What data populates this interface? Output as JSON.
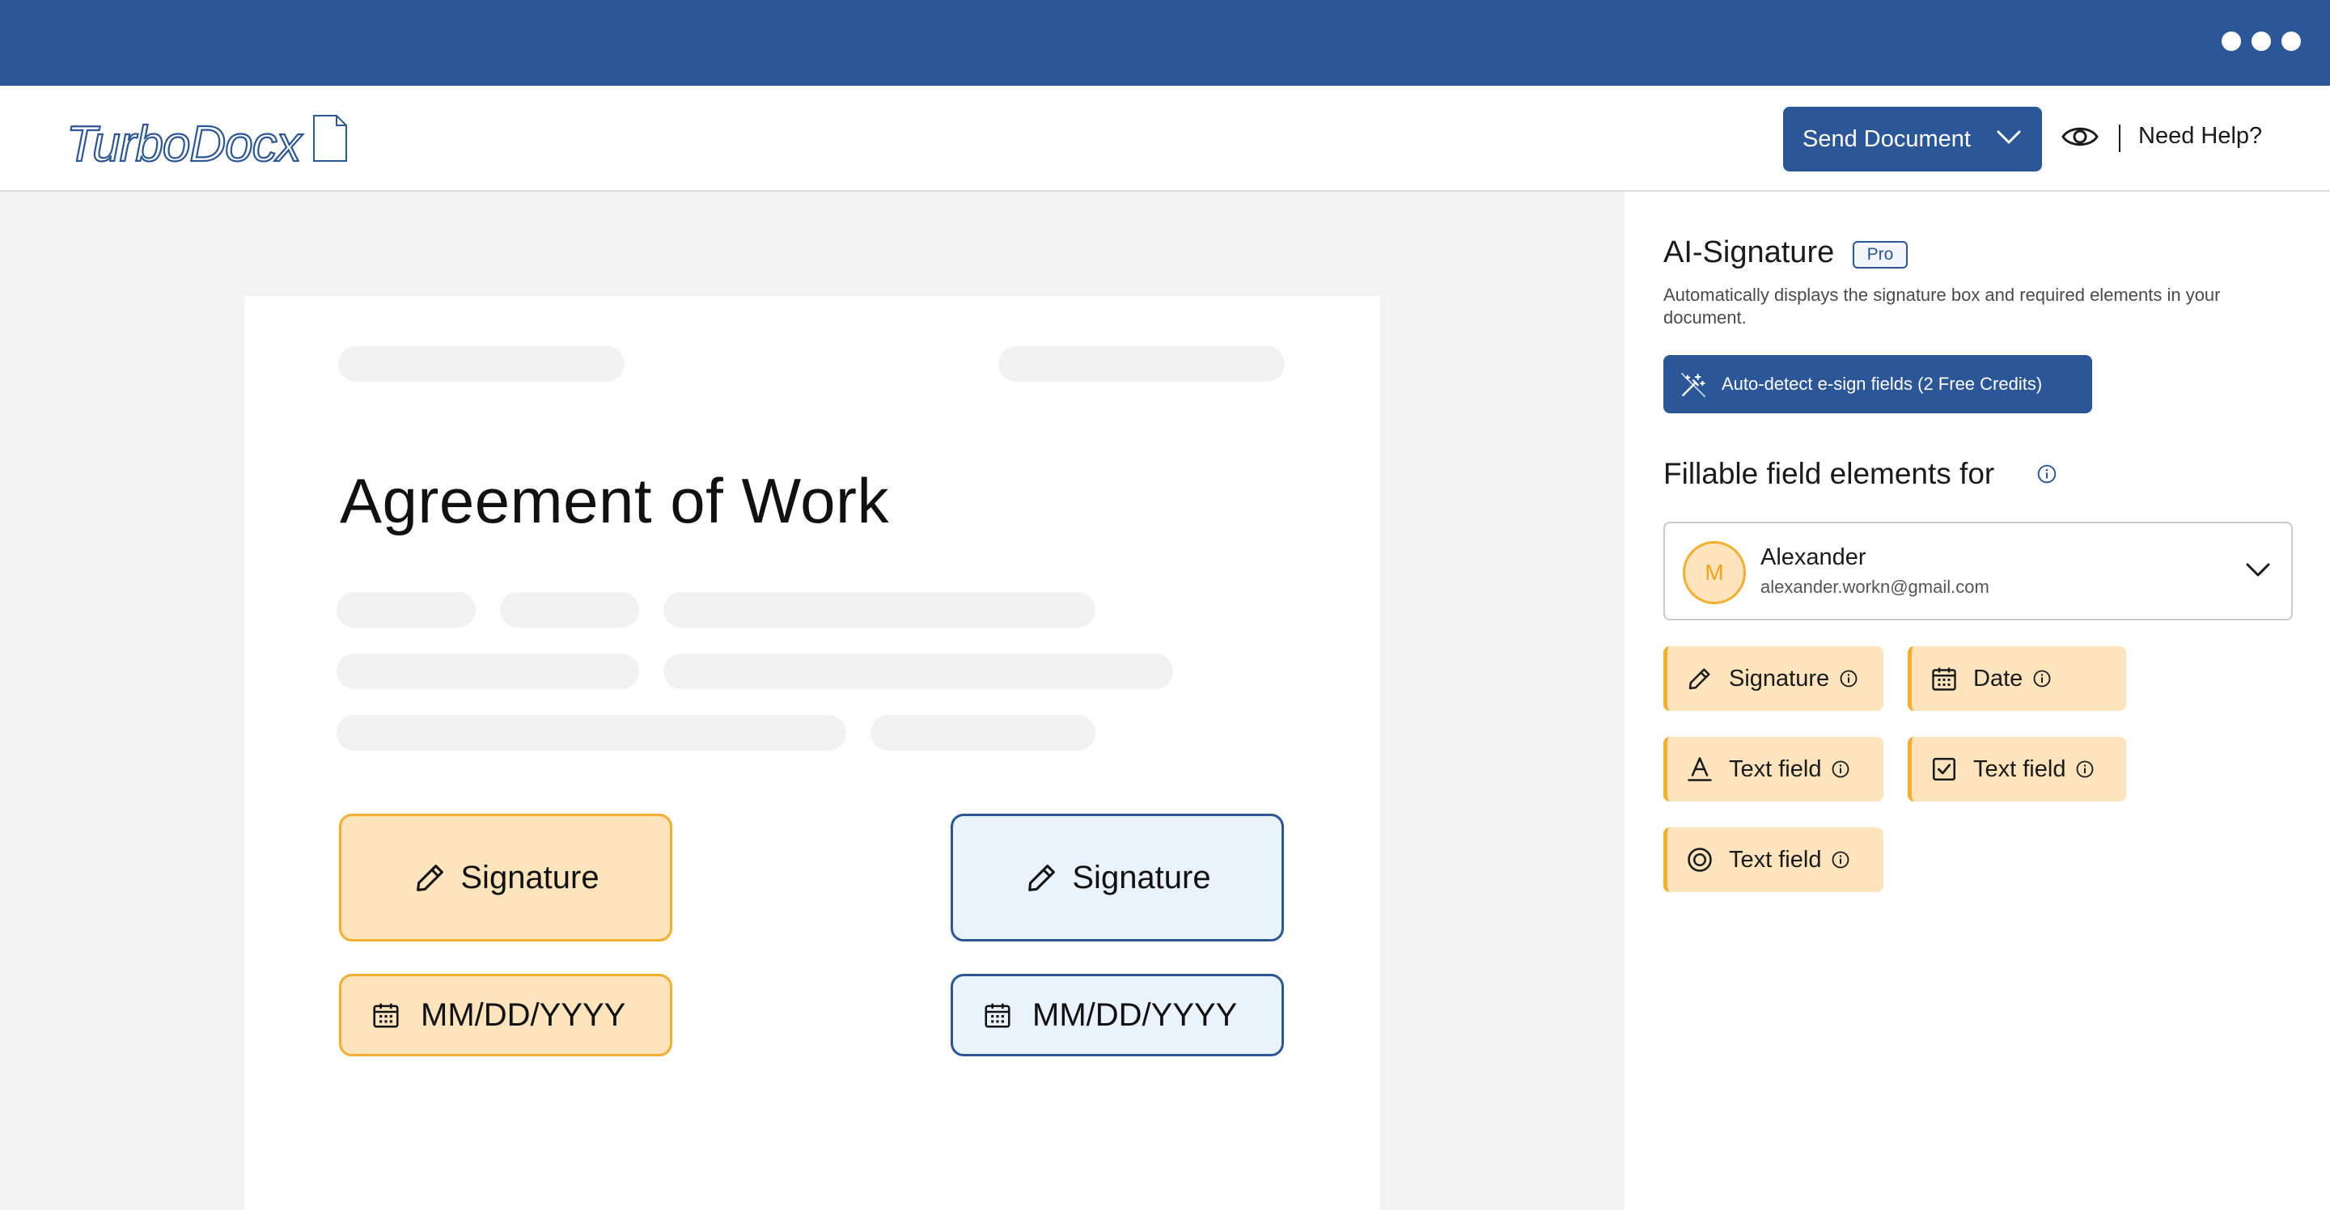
{
  "header": {
    "logo_text": "TurboDocx",
    "send_button": "Send Document",
    "help_link": "Need Help?"
  },
  "document": {
    "title": "Agreement of Work",
    "fields": {
      "signature_left": "Signature",
      "signature_right": "Signature",
      "date_left": "MM/DD/YYYY",
      "date_right": "MM/DD/YYYY"
    }
  },
  "panel": {
    "ai_title": "AI-Signature",
    "badge": "Pro",
    "description": "Automatically displays the signature box and required elements in your document.",
    "auto_detect_button": "Auto-detect e-sign fields (2 Free Credits)",
    "fillable_title": "Fillable field elements for",
    "recipient": {
      "initial": "M",
      "name": "Alexander",
      "email": "alexander.workn@gmail.com"
    },
    "elements": [
      {
        "label": "Signature",
        "icon": "pencil-icon"
      },
      {
        "label": "Date",
        "icon": "calendar-icon"
      },
      {
        "label": "Text field",
        "icon": "text-icon"
      },
      {
        "label": "Text field",
        "icon": "checkbox-icon"
      },
      {
        "label": "Text field",
        "icon": "radio-icon"
      }
    ]
  },
  "colors": {
    "brand_blue": "#2b5697",
    "orange_fill": "#fde4bd",
    "orange_border": "#f6ad2e",
    "blue_fill": "#eaf2fc"
  }
}
